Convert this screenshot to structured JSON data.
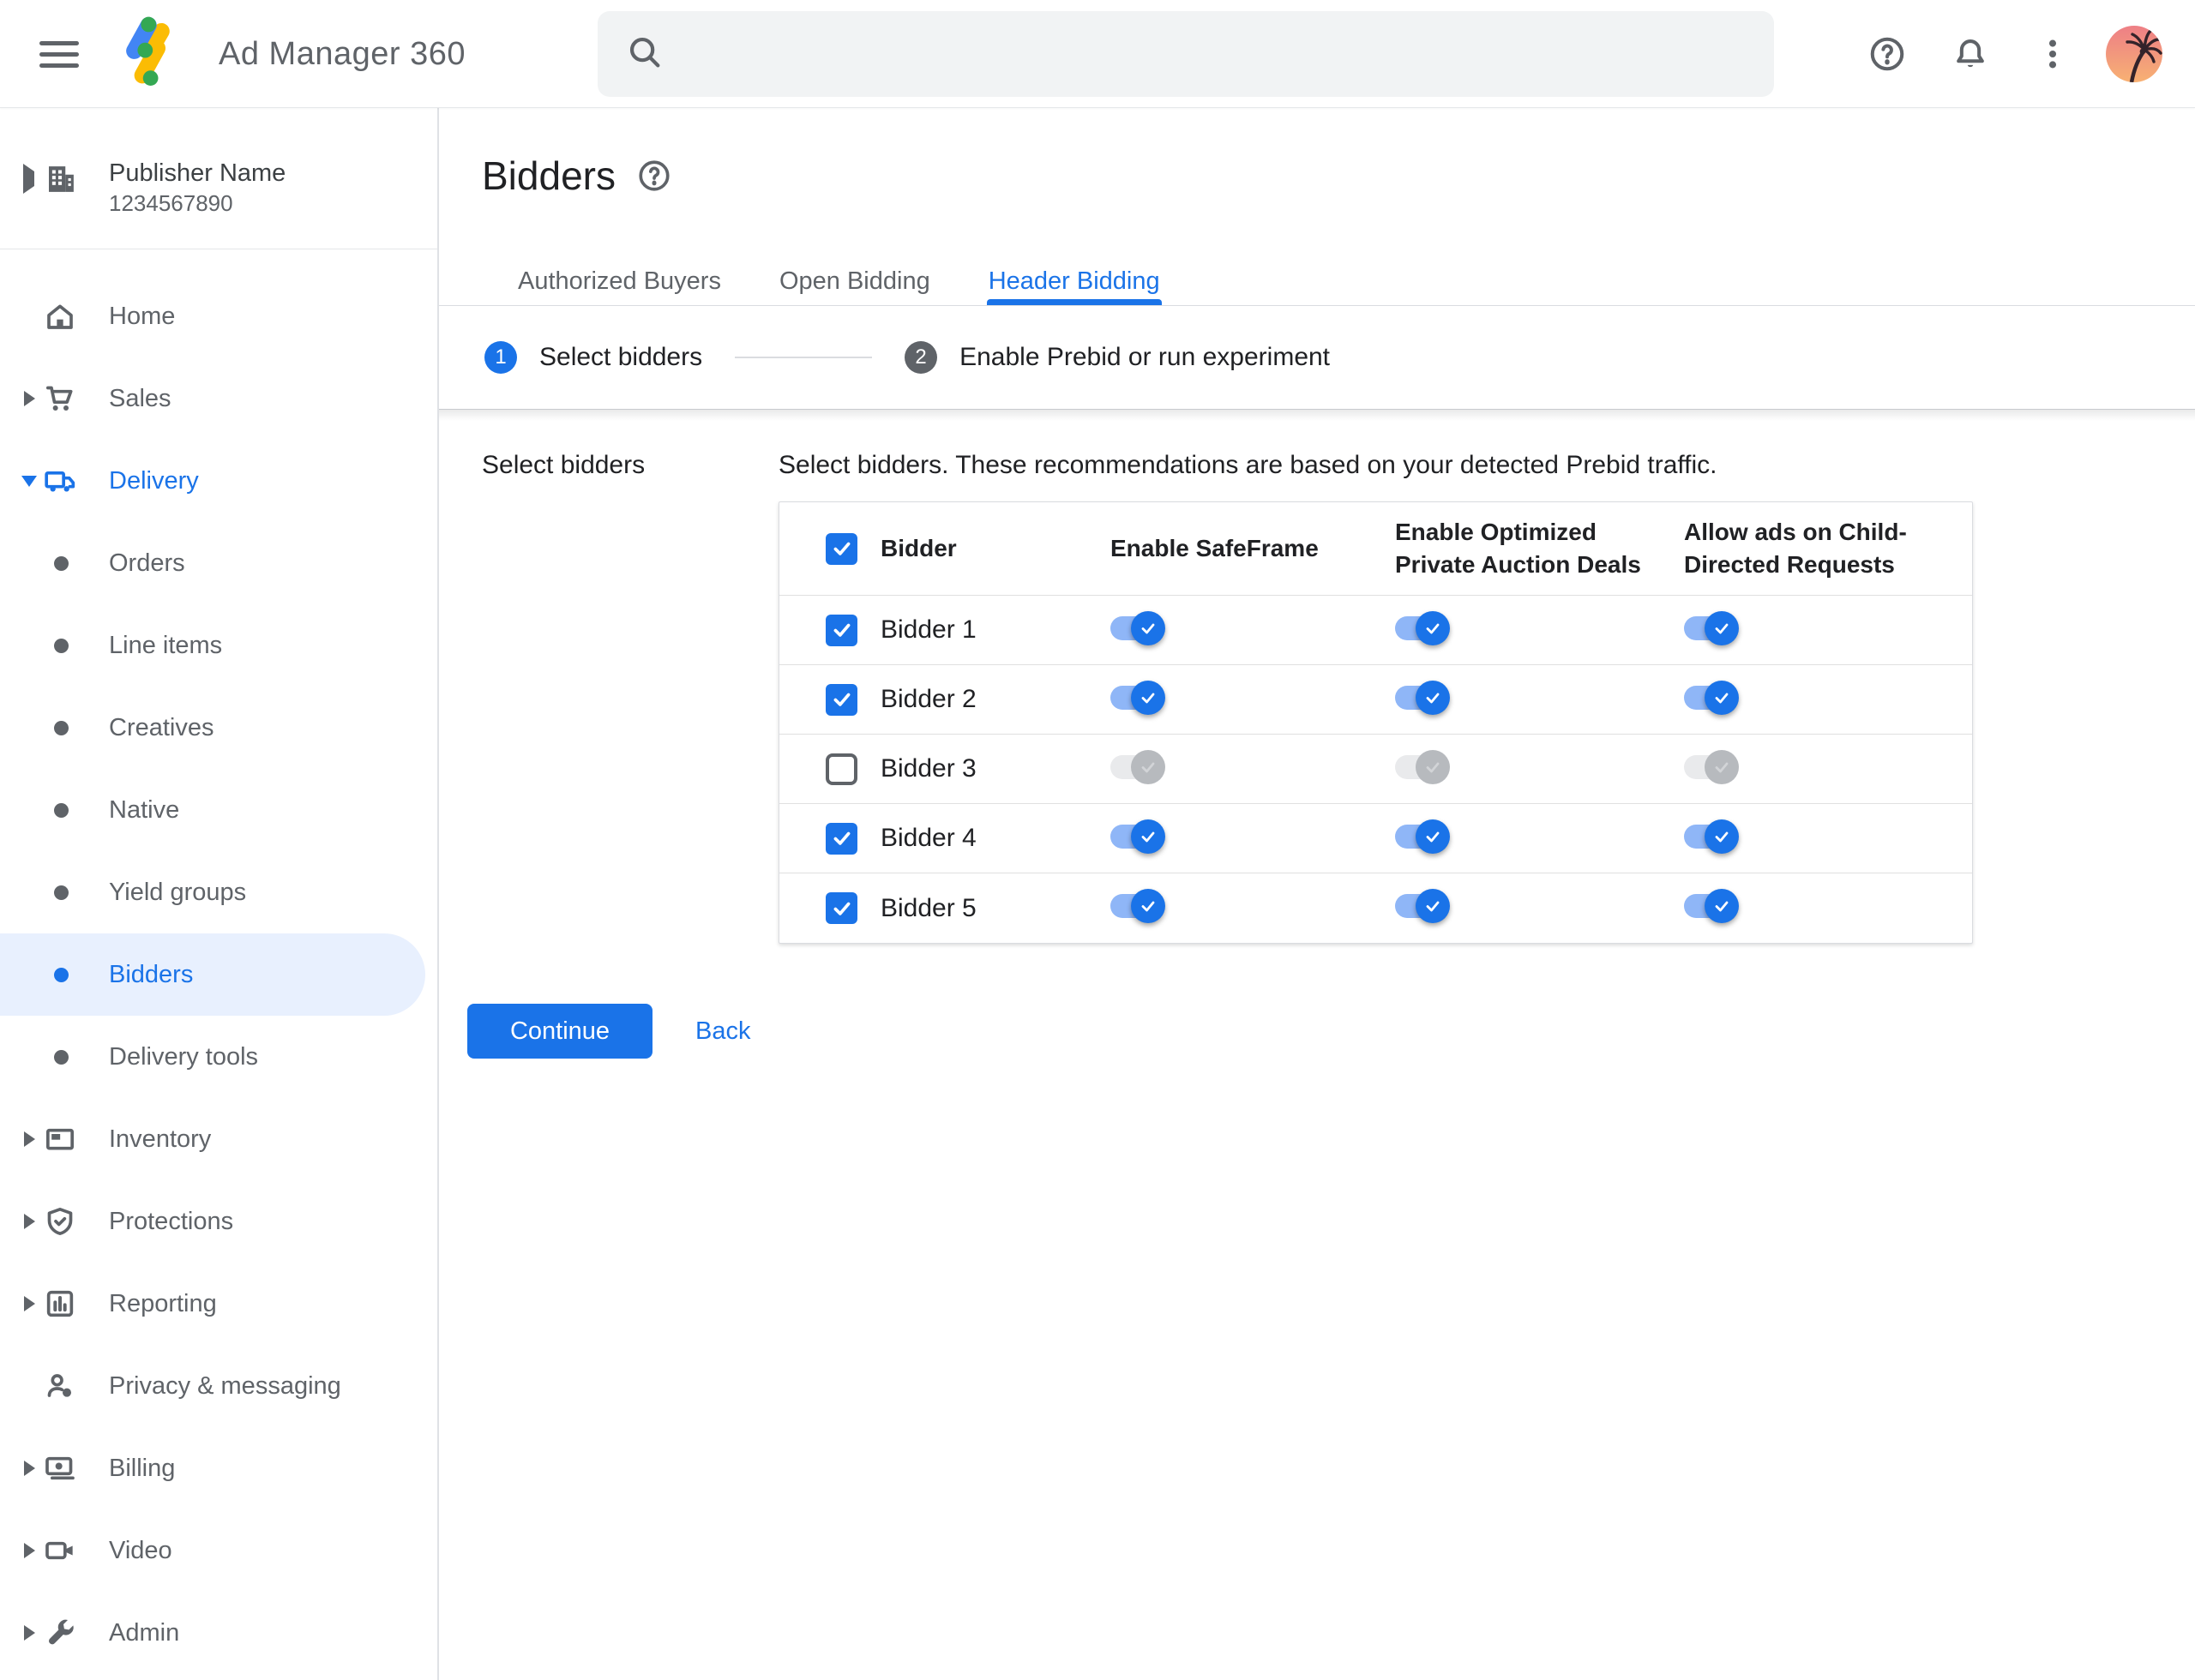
{
  "app": {
    "title": "Ad Manager 360"
  },
  "header": {
    "search_placeholder": "",
    "icons": [
      "menu",
      "search",
      "help",
      "notifications",
      "more-options",
      "avatar"
    ]
  },
  "account": {
    "name": "Publisher Name",
    "id": "1234567890"
  },
  "sidebar": {
    "items": [
      {
        "label": "Home",
        "icon": "home-icon"
      },
      {
        "label": "Sales",
        "icon": "cart-icon",
        "expandable": true
      },
      {
        "label": "Delivery",
        "icon": "truck-icon",
        "expandable": true,
        "expanded": true
      },
      {
        "label": "Orders",
        "icon": "bullet",
        "sub": true
      },
      {
        "label": "Line items",
        "icon": "bullet",
        "sub": true
      },
      {
        "label": "Creatives",
        "icon": "bullet",
        "sub": true
      },
      {
        "label": "Native",
        "icon": "bullet",
        "sub": true
      },
      {
        "label": "Yield groups",
        "icon": "bullet",
        "sub": true
      },
      {
        "label": "Bidders",
        "icon": "bullet",
        "sub": true,
        "selected": true
      },
      {
        "label": "Delivery tools",
        "icon": "bullet",
        "sub": true
      },
      {
        "label": "Inventory",
        "icon": "inventory-icon",
        "expandable": true
      },
      {
        "label": "Protections",
        "icon": "shield-icon",
        "expandable": true
      },
      {
        "label": "Reporting",
        "icon": "chart-icon",
        "expandable": true
      },
      {
        "label": "Privacy & messaging",
        "icon": "person-icon"
      },
      {
        "label": "Billing",
        "icon": "money-icon",
        "expandable": true
      },
      {
        "label": "Video",
        "icon": "video-icon",
        "expandable": true
      },
      {
        "label": "Admin",
        "icon": "wrench-icon",
        "expandable": true
      }
    ]
  },
  "main": {
    "page_title": "Bidders",
    "tabs": [
      {
        "label": "Authorized Buyers",
        "active": false
      },
      {
        "label": "Open Bidding",
        "active": false
      },
      {
        "label": "Header Bidding",
        "active": true
      }
    ],
    "steps": [
      {
        "number": "1",
        "label": "Select bidders",
        "active": true
      },
      {
        "number": "2",
        "label": "Enable Prebid or run experiment",
        "active": false
      }
    ],
    "section_label": "Select bidders",
    "description": "Select bidders. These recommendations are based on your detected Prebid traffic.",
    "table": {
      "header_checkbox_checked": true,
      "columns": [
        "Bidder",
        "Enable SafeFrame",
        "Enable Optimized\nPrivate Auction Deals",
        "Allow ads on Child-\nDirected Requests"
      ],
      "rows": [
        {
          "name": "Bidder 1",
          "checked": true,
          "toggles": [
            true,
            true,
            true
          ]
        },
        {
          "name": "Bidder 2",
          "checked": true,
          "toggles": [
            true,
            true,
            true
          ]
        },
        {
          "name": "Bidder 3",
          "checked": false,
          "toggles": [
            true,
            true,
            true
          ]
        },
        {
          "name": "Bidder 4",
          "checked": true,
          "toggles": [
            true,
            true,
            true
          ]
        },
        {
          "name": "Bidder 5",
          "checked": true,
          "toggles": [
            true,
            true,
            true
          ]
        }
      ]
    },
    "actions": {
      "continue_label": "Continue",
      "back_label": "Back"
    }
  },
  "colors": {
    "accent_blue": "#1a73e8",
    "logo_blue": "#4285f4",
    "logo_yellow": "#fbbc04",
    "logo_green": "#34a853",
    "selected_pill": "#e8f0fe",
    "toggle_track_on": "#8fb6f7",
    "disabled_thumb": "#b7babe",
    "gray_text": "#5f6368",
    "dark_text": "#202124",
    "border": "#dadce0",
    "search_bg": "#f1f3f4"
  }
}
